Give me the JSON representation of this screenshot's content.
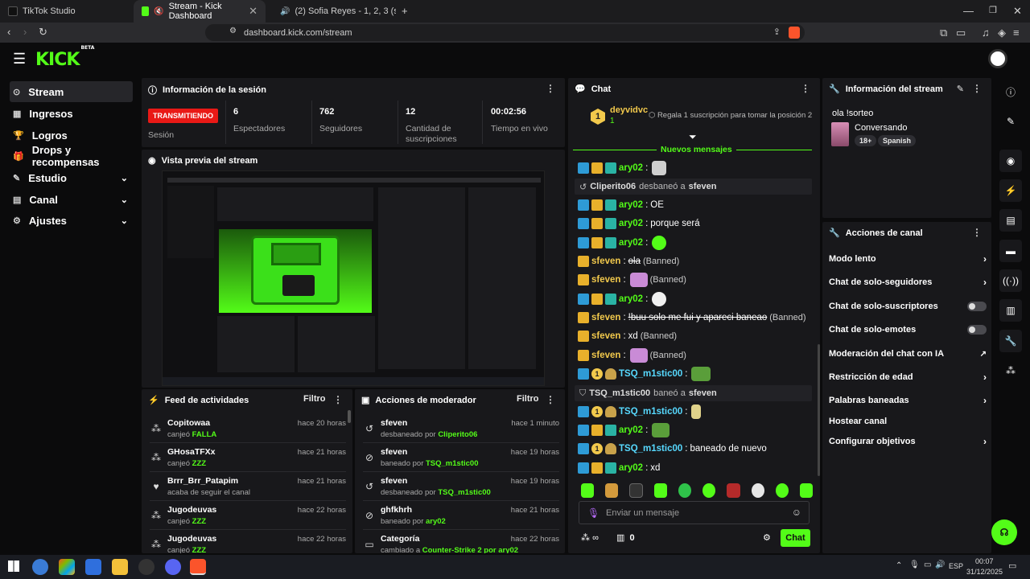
{
  "browser": {
    "tabs": [
      {
        "title": "TikTok Studio"
      },
      {
        "title": "Stream - Kick Dashboard"
      },
      {
        "title": "(2) Sofia Reyes - 1, 2, 3 (sped up)"
      }
    ],
    "url": "dashboard.kick.com/stream"
  },
  "app": {
    "logo": "KICK",
    "logo_tag": "BETA"
  },
  "sidebar": {
    "items": [
      {
        "label": "Stream"
      },
      {
        "label": "Ingresos"
      },
      {
        "label": "Logros"
      },
      {
        "label": "Drops y recompensas"
      },
      {
        "label": "Estudio"
      },
      {
        "label": "Canal"
      },
      {
        "label": "Ajustes"
      }
    ]
  },
  "session": {
    "title": "Información de la sesión",
    "status_badge": "TRANSMITIENDO",
    "status_label": "Sesión",
    "viewers": "6",
    "viewers_label": "Espectadores",
    "followers": "762",
    "followers_label": "Seguidores",
    "subs": "12",
    "subs_label": "Cantidad de suscripciones",
    "uptime": "00:02:56",
    "uptime_label": "Tiempo en vivo"
  },
  "preview": {
    "title": "Vista previa del stream"
  },
  "feed": {
    "title": "Feed de actividades",
    "filter": "Filtro",
    "rows": [
      {
        "name": "Copitowaa",
        "action": "canjeó",
        "item": "FALLA",
        "time": "hace 20 horas"
      },
      {
        "name": "GHosaTFXx",
        "action": "canjeó",
        "item": "ZZZ",
        "time": "hace 21 horas"
      },
      {
        "name": "Brrr_Brr_Patapim",
        "action": "acaba de seguir el canal",
        "item": "",
        "time": "hace 21 horas"
      },
      {
        "name": "Jugodeuvas",
        "action": "canjeó",
        "item": "ZZZ",
        "time": "hace 22 horas"
      },
      {
        "name": "Jugodeuvas",
        "action": "canjeó",
        "item": "ZZZ",
        "time": "hace 22 horas"
      }
    ]
  },
  "modactions": {
    "title": "Acciones de moderador",
    "filter": "Filtro",
    "rows": [
      {
        "name": "sfeven",
        "action": "desbaneado por",
        "by": "Cliperito06",
        "time": "hace 1 minuto"
      },
      {
        "name": "sfeven",
        "action": "baneado por",
        "by": "TSQ_m1stic00",
        "time": "hace 19 horas"
      },
      {
        "name": "sfeven",
        "action": "desbaneado por",
        "by": "TSQ_m1stic00",
        "time": "hace 19 horas"
      },
      {
        "name": "ghfkhrh",
        "action": "baneado por",
        "by": "ary02",
        "time": "hace 21 horas"
      },
      {
        "name": "Categoría",
        "action": "cambiado a",
        "by": "Counter-Strike 2 por ary02",
        "time": "hace 22 horas"
      }
    ]
  },
  "chat": {
    "title": "Chat",
    "top_user": "deyvidvc",
    "top_rank": "1",
    "top_count": "1",
    "gift_prompt": "Regala 1 suscripción para tomar la posición 2",
    "new_messages": "Nuevos mensajes",
    "messages": [
      {
        "user": "ary02",
        "text": ""
      },
      {
        "system": "Cliperito06",
        "verb": "desbaneó a",
        "target": "sfeven"
      },
      {
        "user": "ary02",
        "text": "OE"
      },
      {
        "user": "ary02",
        "text": "porque será"
      },
      {
        "user": "ary02",
        "text": ""
      },
      {
        "user": "sfeven",
        "text": "ola",
        "banned": "(Banned)"
      },
      {
        "user": "sfeven",
        "text": "",
        "banned": "(Banned)"
      },
      {
        "user": "ary02",
        "text": ""
      },
      {
        "user": "sfeven",
        "text": "!buu solo me fui y apareci baneao",
        "banned": "(Banned)"
      },
      {
        "user": "sfeven",
        "text": "xd",
        "banned": "(Banned)"
      },
      {
        "user": "sfeven",
        "text": "",
        "banned": "(Banned)"
      },
      {
        "user": "TSQ_m1stic00",
        "text": ""
      },
      {
        "system": "TSQ_m1stic00",
        "verb": "baneó a",
        "target": "sfeven"
      },
      {
        "user": "TSQ_m1stic00",
        "text": ""
      },
      {
        "user": "ary02",
        "text": ""
      },
      {
        "user": "TSQ_m1stic00",
        "text": "baneado de nuevo"
      },
      {
        "user": "ary02",
        "text": "xd"
      }
    ],
    "input_placeholder": "Enviar un mensaje",
    "points": "∞",
    "gift_count": "0",
    "send_label": "Chat"
  },
  "streaminfo": {
    "title": "Información del stream",
    "stream_title": "ola !sorteo",
    "category": "Conversando",
    "tag_age": "18+",
    "tag_lang": "Spanish"
  },
  "channelactions": {
    "title": "Acciones de canal",
    "items": [
      {
        "label": "Modo lento"
      },
      {
        "label": "Chat de solo-seguidores"
      },
      {
        "label": "Chat de solo-suscriptores"
      },
      {
        "label": "Chat de solo-emotes"
      },
      {
        "label": "Moderación del chat con IA"
      },
      {
        "label": "Restricción de edad"
      },
      {
        "label": "Palabras baneadas"
      },
      {
        "label": "Hostear canal"
      },
      {
        "label": "Configurar objetivos"
      }
    ]
  },
  "taskbar": {
    "lang": "ESP",
    "time": "00:07",
    "date": "31/12/2025"
  },
  "colors": {
    "accent": "#53fc18",
    "live": "#e91916",
    "panel": "#18181b"
  }
}
